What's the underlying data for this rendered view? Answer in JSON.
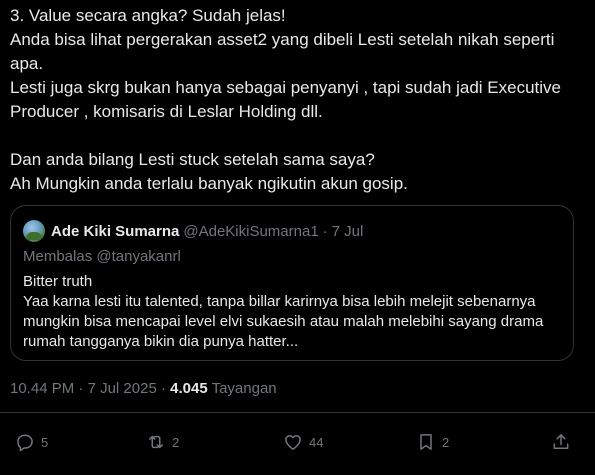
{
  "tweet": {
    "lines": [
      "3. Value secara angka? Sudah jelas!",
      "Anda bisa lihat pergerakan asset2 yang dibeli Lesti setelah nikah seperti",
      "apa.",
      "Lesti juga skrg bukan hanya sebagai penyanyi , tapi sudah jadi Executive",
      "Producer , komisaris di Leslar Holding dll.",
      "",
      "Dan anda bilang Lesti stuck setelah sama saya?",
      "Ah Mungkin anda terlalu banyak ngikutin akun gosip."
    ]
  },
  "quote": {
    "name": "Ade Kiki Sumarna",
    "handle": "@AdeKikiSumarna1",
    "separator": "·",
    "date": "7 Jul",
    "reply_to": "Membalas @tanyakanrl",
    "lines": [
      "Bitter truth",
      "Yaa karna lesti itu talented, tanpa billar karirnya bisa lebih melejit sebenarnya",
      "mungkin bisa mencapai level elvi sukaesih atau malah melebihi sayang drama",
      "rumah tangganya bikin dia punya hatter..."
    ]
  },
  "meta": {
    "time": "10.44 PM",
    "separator1": "·",
    "date": "7 Jul 2025",
    "separator2": "·",
    "views": "4.045",
    "views_label": "Tayangan"
  },
  "actions": {
    "reply_count": "5",
    "retweet_count": "2",
    "like_count": "44",
    "bookmark_count": "2"
  },
  "icons": [
    "reply-icon",
    "retweet-icon",
    "like-icon",
    "bookmark-icon",
    "share-icon"
  ],
  "colors": {
    "background": "#000000",
    "text": "#e7e9ea",
    "secondary": "#71767b",
    "border": "#2f3336"
  }
}
